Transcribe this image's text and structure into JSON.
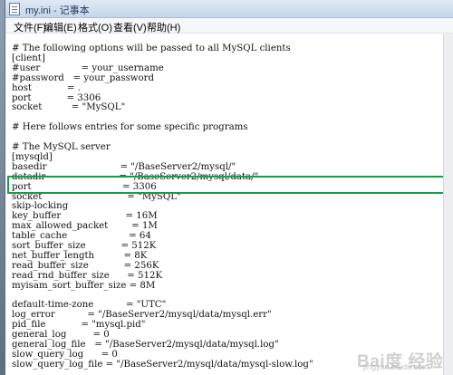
{
  "window": {
    "title": "my.ini - 记事本"
  },
  "menu": {
    "items": [
      "文件(F)",
      "编辑(E)",
      "格式(O)",
      "查看(V)",
      "帮助(H)"
    ]
  },
  "editor": {
    "lines": [
      "# The following options will be passed to all MySQL clients",
      "[client]",
      "#user              = your_username",
      "#password   = your_password",
      "host            = .",
      "port            = 3306",
      "socket          = \"MySQL\"",
      "",
      "# Here follows entries for some specific programs",
      "",
      "# The MySQL server",
      "[mysqld]",
      "basedir                         = \"/BaseServer2/mysql/\"",
      "datadir                         = \"/BaseServer2/mysql/data/\"",
      "port                               = 3306",
      "socket                             = \"MySQL\"",
      "skip-locking",
      "key_buffer                      = 16M",
      "max_allowed_packet        = 1M",
      "table_cache                     = 64",
      "sort_buffer_size            = 512K",
      "net_buffer_length          = 8K",
      "read_buffer_size            = 256K",
      "read_rnd_buffer_size      = 512K",
      "myisam_sort_buffer_size = 8M",
      "",
      "default-time-zone           = \"UTC\"",
      "log_error           = \"/BaseServer2/mysql/data/mysql.err\"",
      "pid_file            = \"mysql.pid\"",
      "general_log         = 0",
      "general_log_file   = \"/BaseServer2/mysql/data/mysql.log\"",
      "slow_query_log      = 0",
      "slow_query_log_file = \"/BaseServer2/mysql/data/mysql-slow.log\""
    ]
  },
  "highlight": {
    "color": "#1d9a47"
  },
  "watermark": {
    "brand": "Bai度 经验",
    "sub": "jingyan.baidu.com"
  }
}
